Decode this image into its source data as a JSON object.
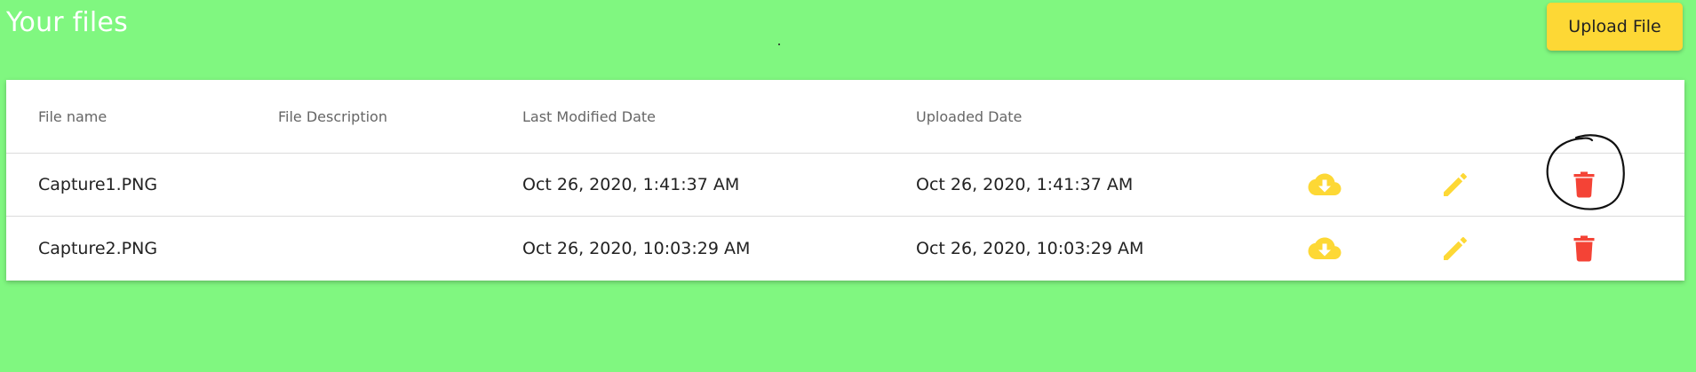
{
  "page": {
    "title": "Your files",
    "upload_label": "Upload File"
  },
  "table": {
    "columns": [
      "File name",
      "File Description",
      "Last Modified Date",
      "Uploaded Date"
    ],
    "rows": [
      {
        "file_name": "Capture1.PNG",
        "description": "",
        "last_modified": "Oct 26, 2020, 1:41:37 AM",
        "uploaded": "Oct 26, 2020, 1:41:37 AM"
      },
      {
        "file_name": "Capture2.PNG",
        "description": "",
        "last_modified": "Oct 26, 2020, 10:03:29 AM",
        "uploaded": "Oct 26, 2020, 10:03:29 AM"
      }
    ]
  },
  "icons": {
    "download": "cloud-download-icon",
    "edit": "pencil-icon",
    "delete": "trash-icon"
  },
  "colors": {
    "background": "#80f780",
    "accent_yellow": "#fdd835",
    "delete_red": "#f44336"
  }
}
